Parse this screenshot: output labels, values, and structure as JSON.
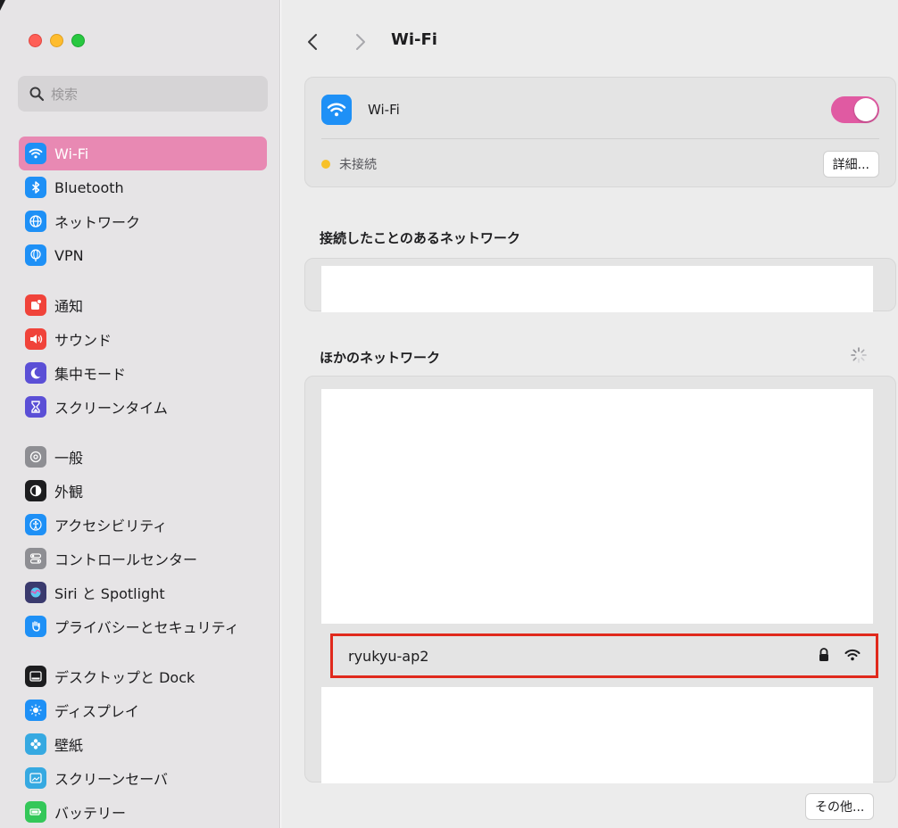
{
  "window": {
    "traffic_lights": [
      "close",
      "minimize",
      "zoom"
    ]
  },
  "search": {
    "placeholder": "検索"
  },
  "sidebar": {
    "items": [
      {
        "label": "Wi-Fi",
        "icon": "wifi-icon",
        "color": "#1e90f6",
        "active": true
      },
      {
        "label": "Bluetooth",
        "icon": "bluetooth-icon",
        "color": "#1e90f6"
      },
      {
        "label": "ネットワーク",
        "icon": "globe-icon",
        "color": "#1e90f6"
      },
      {
        "label": "VPN",
        "icon": "vpn-globe-icon",
        "color": "#1e90f6"
      },
      {
        "label": "通知",
        "icon": "bell-icon",
        "color": "#f0433a"
      },
      {
        "label": "サウンド",
        "icon": "speaker-icon",
        "color": "#f0433a"
      },
      {
        "label": "集中モード",
        "icon": "moon-icon",
        "color": "#5b4fd6"
      },
      {
        "label": "スクリーンタイム",
        "icon": "hourglass-icon",
        "color": "#5b4fd6"
      },
      {
        "label": "一般",
        "icon": "gear-icon",
        "color": "#8e8e93"
      },
      {
        "label": "外観",
        "icon": "appearance-icon",
        "color": "#1d1d1f"
      },
      {
        "label": "アクセシビリティ",
        "icon": "accessibility-icon",
        "color": "#1e90f6"
      },
      {
        "label": "コントロールセンター",
        "icon": "control-center-icon",
        "color": "#8e8e93"
      },
      {
        "label": "Siri と Spotlight",
        "icon": "siri-icon",
        "color": "#3a3a6e"
      },
      {
        "label": "プライバシーとセキュリティ",
        "icon": "hand-icon",
        "color": "#1e90f6"
      },
      {
        "label": "デスクトップと Dock",
        "icon": "dock-icon",
        "color": "#1d1d1f"
      },
      {
        "label": "ディスプレイ",
        "icon": "sun-icon",
        "color": "#1e90f6"
      },
      {
        "label": "壁紙",
        "icon": "flower-icon",
        "color": "#36a9e1"
      },
      {
        "label": "スクリーンセーバ",
        "icon": "screensaver-icon",
        "color": "#36a9e1"
      },
      {
        "label": "バッテリー",
        "icon": "battery-icon",
        "color": "#34c759"
      }
    ]
  },
  "header": {
    "title": "Wi-Fi"
  },
  "wifi": {
    "label": "Wi-Fi",
    "enabled": true,
    "toggle_color": "#e05aa2",
    "status": "未接続",
    "status_color": "#f7c12a",
    "details_label": "詳細..."
  },
  "known_networks": {
    "title": "接続したことのあるネットワーク"
  },
  "other_networks": {
    "title": "ほかのネットワーク",
    "items": [
      {
        "name": "ryukyu-ap2",
        "secured": true,
        "highlighted": true
      }
    ],
    "other_label": "その他..."
  },
  "colors": {
    "highlight_border": "#e0291c",
    "sidebar_active": "#e889b3"
  }
}
